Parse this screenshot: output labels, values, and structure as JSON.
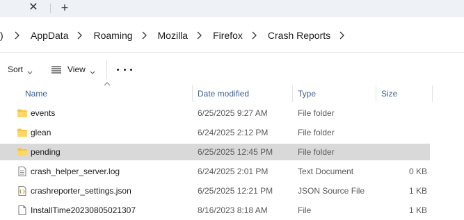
{
  "tabstrip": {
    "close_glyph": "✕",
    "new_tab_glyph": "+"
  },
  "breadcrumbs": {
    "lead": ")",
    "items": [
      "AppData",
      "Roaming",
      "Mozilla",
      "Firefox",
      "Crash Reports"
    ]
  },
  "commandbar": {
    "sort_label": "Sort",
    "view_label": "View",
    "more_icon": "ellipsis-icon"
  },
  "columns": {
    "name": "Name",
    "date": "Date modified",
    "type": "Type",
    "size": "Size"
  },
  "files": [
    {
      "name": "events",
      "date": "6/25/2025 9:27 AM",
      "type": "File folder",
      "size": "",
      "icon": "folder-icon",
      "selected": false
    },
    {
      "name": "glean",
      "date": "6/24/2025 2:12 PM",
      "type": "File folder",
      "size": "",
      "icon": "folder-icon",
      "selected": false
    },
    {
      "name": "pending",
      "date": "6/25/2025 12:45 PM",
      "type": "File folder",
      "size": "",
      "icon": "folder-icon",
      "selected": true
    },
    {
      "name": "crash_helper_server.log",
      "date": "6/24/2025 2:01 PM",
      "type": "Text Document",
      "size": "0 KB",
      "icon": "text-file-icon",
      "selected": false
    },
    {
      "name": "crashreporter_settings.json",
      "date": "6/25/2025 12:21 PM",
      "type": "JSON Source File",
      "size": "1 KB",
      "icon": "json-file-icon",
      "selected": false
    },
    {
      "name": "InstallTime20230805021307",
      "date": "8/16/2023 8:18 AM",
      "type": "File",
      "size": "1 KB",
      "icon": "file-icon",
      "selected": false
    }
  ],
  "colors": {
    "folder": "#f8c43c",
    "selected_row": "#d9d9d9",
    "header_text": "#3b5f8f"
  }
}
